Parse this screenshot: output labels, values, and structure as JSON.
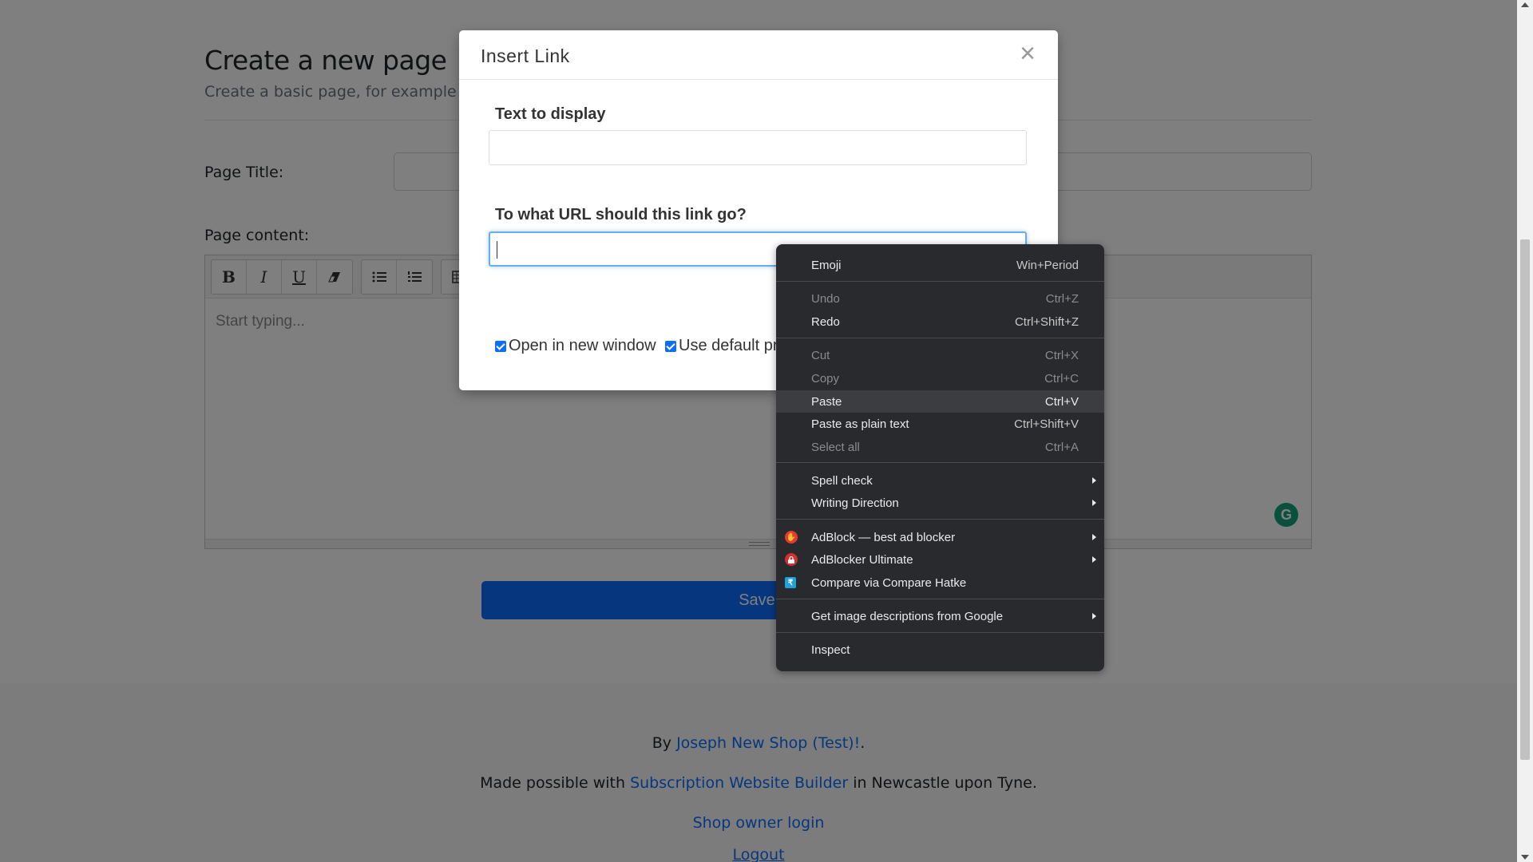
{
  "page": {
    "heading": "Create a new page",
    "subheading": "Create a basic page, for example an 'a",
    "page_title_label": "Page Title:",
    "page_content_label": "Page content:",
    "editor_placeholder": "Start typing...",
    "save_label": "Save",
    "toolbar": {
      "bold": "B",
      "italic": "I",
      "underline": "U"
    }
  },
  "footer": {
    "by_prefix": "By ",
    "shop_name": "Joseph New Shop (Test)!",
    "by_suffix": ".",
    "made_prefix": "Made possible with ",
    "builder_link": "Subscription Website Builder",
    "made_suffix": " in Newcastle upon Tyne.",
    "owner_login": "Shop owner login",
    "logout": "Logout"
  },
  "modal": {
    "title": "Insert Link",
    "close_glyph": "×",
    "text_label": "Text to display",
    "text_value": "",
    "url_label": "To what URL should this link go?",
    "url_value": "",
    "open_new_window": "Open in new window",
    "use_default_protocol": "Use default pr"
  },
  "context_menu": {
    "emoji": {
      "label": "Emoji",
      "shortcut": "Win+Period"
    },
    "undo": {
      "label": "Undo",
      "shortcut": "Ctrl+Z"
    },
    "redo": {
      "label": "Redo",
      "shortcut": "Ctrl+Shift+Z"
    },
    "cut": {
      "label": "Cut",
      "shortcut": "Ctrl+X"
    },
    "copy": {
      "label": "Copy",
      "shortcut": "Ctrl+C"
    },
    "paste": {
      "label": "Paste",
      "shortcut": "Ctrl+V"
    },
    "paste_plain": {
      "label": "Paste as plain text",
      "shortcut": "Ctrl+Shift+V"
    },
    "select_all": {
      "label": "Select all",
      "shortcut": "Ctrl+A"
    },
    "spell_check": {
      "label": "Spell check"
    },
    "writing_direction": {
      "label": "Writing Direction"
    },
    "adblock": {
      "label": "AdBlock — best ad blocker"
    },
    "adblocker_ultimate": {
      "label": "AdBlocker Ultimate"
    },
    "compare_hatke": {
      "label": "Compare via Compare Hatke"
    },
    "image_descriptions": {
      "label": "Get image descriptions from Google"
    },
    "inspect": {
      "label": "Inspect"
    }
  },
  "colors": {
    "accent": "#0d6efd",
    "menu_bg": "#292a2d",
    "overlay": "rgba(0,0,0,0.5)"
  }
}
